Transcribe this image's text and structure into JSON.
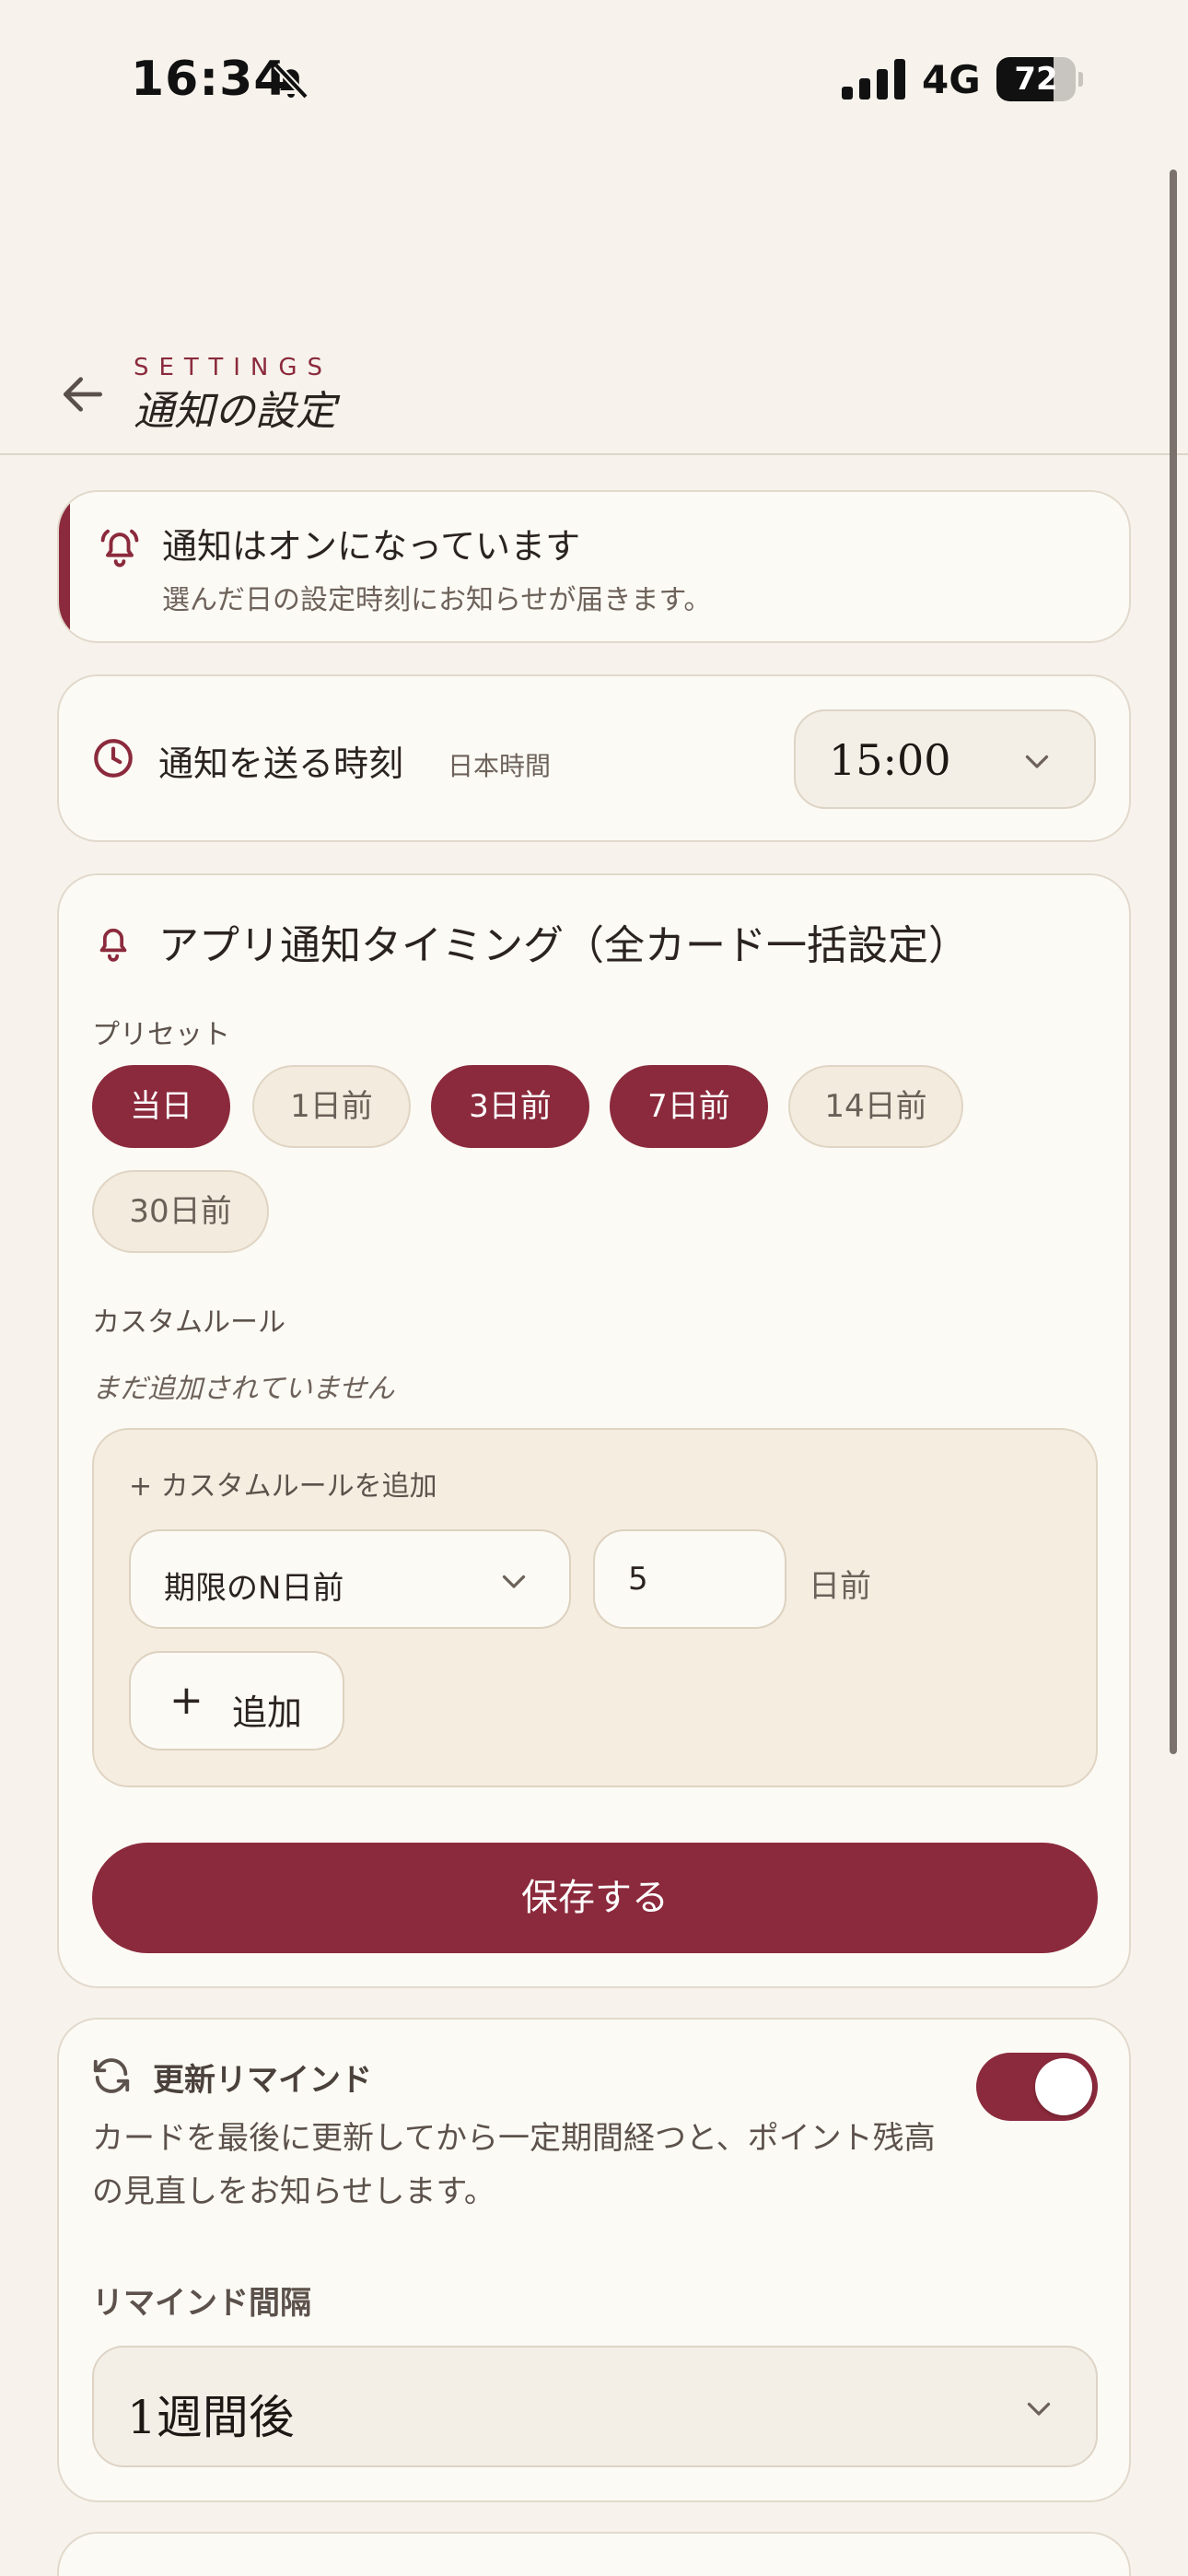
{
  "status_bar": {
    "time": "16:34",
    "network": "4G",
    "battery": "72",
    "battery_level": 0.72
  },
  "header": {
    "eyebrow": "SETTINGS",
    "title": "通知の設定"
  },
  "banner": {
    "title": "通知はオンになっています",
    "subtitle": "選んだ日の設定時刻にお知らせが届きます。"
  },
  "send_time": {
    "label": "通知を送る時刻",
    "note": "日本時間",
    "value": "15:00"
  },
  "timing": {
    "title": "アプリ通知タイミング（全カード一括設定）",
    "preset_label": "プリセット",
    "presets": [
      {
        "label": "当日",
        "selected": true
      },
      {
        "label": "1日前",
        "selected": false
      },
      {
        "label": "3日前",
        "selected": true
      },
      {
        "label": "7日前",
        "selected": true
      },
      {
        "label": "14日前",
        "selected": false
      },
      {
        "label": "30日前",
        "selected": false
      }
    ],
    "custom_label": "カスタムルール",
    "custom_empty": "まだ追加されていません",
    "add_panel": {
      "title": "+ カスタムルールを追加",
      "rule_type": "期限のN日前",
      "days_value": "5",
      "days_unit": "日前",
      "add_icon": "+",
      "add_label": "追加"
    },
    "save_label": "保存する"
  },
  "remind": {
    "title": "更新リマインド",
    "description": "カードを最後に更新してから一定期間経つと、ポイント残高の見直しをお知らせします。",
    "enabled": true,
    "interval_label": "リマインド間隔",
    "interval_value": "1週間後"
  },
  "colors": {
    "accent": "#8b2a3c",
    "background": "#f7f3ec",
    "card": "#fcfaf5",
    "chip_off": "#f3ebdd"
  },
  "icons": {
    "mute": "bell-slash-icon",
    "back": "arrow-left-icon",
    "banner": "bell-icon",
    "time": "clock-icon",
    "timing": "bell-icon",
    "remind": "refresh-icon",
    "select": "chevron-down-icon"
  }
}
